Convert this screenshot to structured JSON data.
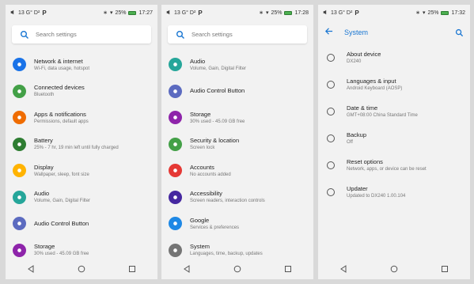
{
  "status_bar": {
    "left_text": "13 G° D²",
    "battery_text": "25%",
    "times": [
      "17:27",
      "17:28",
      "17:32"
    ]
  },
  "search": {
    "placeholder": "Search settings"
  },
  "panel1": {
    "items": [
      {
        "title": "Network & internet",
        "subtitle": "Wi-Fi, data usage, hotspot",
        "color": "#1a73e8",
        "icon": "wifi-icon"
      },
      {
        "title": "Connected devices",
        "subtitle": "Bluetooth",
        "color": "#43a047",
        "icon": "devices-icon"
      },
      {
        "title": "Apps & notifications",
        "subtitle": "Permissions, default apps",
        "color": "#ef6c00",
        "icon": "apps-icon"
      },
      {
        "title": "Battery",
        "subtitle": "25% - 7 hr, 19 min left until fully charged",
        "color": "#2e7d32",
        "icon": "battery-icon"
      },
      {
        "title": "Display",
        "subtitle": "Wallpaper, sleep, font size",
        "color": "#ffb300",
        "icon": "display-icon"
      },
      {
        "title": "Audio",
        "subtitle": "Volume, Gain, Digital Filter",
        "color": "#26a69a",
        "icon": "audio-icon"
      },
      {
        "title": "Audio Control Button",
        "subtitle": "",
        "color": "#5c6bc0",
        "icon": "audio-control-icon"
      },
      {
        "title": "Storage",
        "subtitle": "30% used - 45.09 GB free",
        "color": "#8e24aa",
        "icon": "storage-icon"
      }
    ]
  },
  "panel2": {
    "items": [
      {
        "title": "Audio",
        "subtitle": "Volume, Gain, Digital Filter",
        "color": "#26a69a",
        "icon": "audio-icon"
      },
      {
        "title": "Audio Control Button",
        "subtitle": "",
        "color": "#5c6bc0",
        "icon": "audio-control-icon"
      },
      {
        "title": "Storage",
        "subtitle": "30% used - 45.09 GB free",
        "color": "#8e24aa",
        "icon": "storage-icon"
      },
      {
        "title": "Security & location",
        "subtitle": "Screen lock",
        "color": "#43a047",
        "icon": "lock-icon"
      },
      {
        "title": "Accounts",
        "subtitle": "No accounts added",
        "color": "#e53935",
        "icon": "account-icon"
      },
      {
        "title": "Accessibility",
        "subtitle": "Screen readers, interaction controls",
        "color": "#4527a0",
        "icon": "accessibility-icon"
      },
      {
        "title": "Google",
        "subtitle": "Services & preferences",
        "color": "#1e88e5",
        "icon": "google-icon"
      },
      {
        "title": "System",
        "subtitle": "Languages, time, backup, updates",
        "color": "#757575",
        "icon": "info-icon"
      }
    ]
  },
  "panel3": {
    "title": "System",
    "items": [
      {
        "title": "About device",
        "subtitle": "DX240",
        "icon": "info-outline-icon"
      },
      {
        "title": "Languages & input",
        "subtitle": "Android Keyboard (AOSP)",
        "icon": "globe-icon"
      },
      {
        "title": "Date & time",
        "subtitle": "GMT+08:00 China Standard Time",
        "icon": "clock-icon"
      },
      {
        "title": "Backup",
        "subtitle": "Off",
        "icon": "cloud-icon"
      },
      {
        "title": "Reset options",
        "subtitle": "Network, apps, or device can be reset",
        "icon": "history-icon"
      },
      {
        "title": "Updater",
        "subtitle": "Updated to DX240 1.00.104",
        "icon": "phone-update-icon"
      }
    ]
  }
}
